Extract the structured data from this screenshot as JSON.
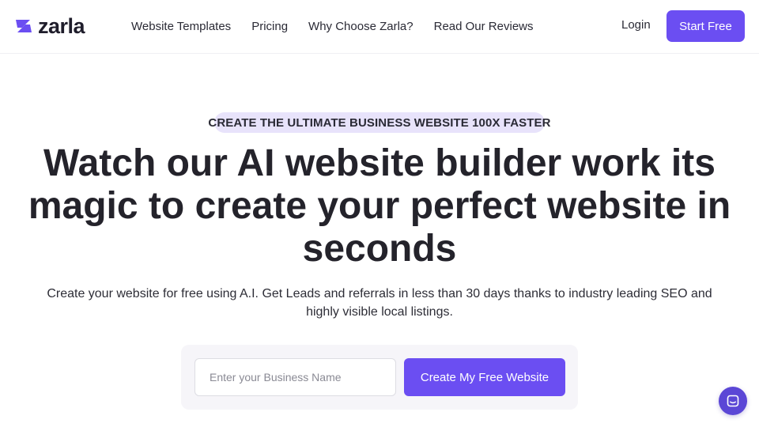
{
  "brand": {
    "name": "zarla",
    "accent_color": "#6b4ef2",
    "logo_icon": "zarla-logo-icon"
  },
  "nav": {
    "items": [
      {
        "label": "Website Templates"
      },
      {
        "label": "Pricing"
      },
      {
        "label": "Why Choose Zarla?"
      },
      {
        "label": "Read Our Reviews"
      }
    ],
    "login_label": "Login",
    "start_label": "Start Free"
  },
  "hero": {
    "tagline": "CREATE THE ULTIMATE BUSINESS WEBSITE 100X FASTER",
    "headline": "Watch our AI website builder work its magic to create your perfect website in seconds",
    "subtext": "Create your website for free using A.I. Get Leads and referrals in less than 30 days thanks to industry leading SEO and highly visible local listings."
  },
  "form": {
    "business_name_placeholder": "Enter your Business Name",
    "business_name_value": "",
    "submit_label": "Create My Free Website"
  },
  "chat": {
    "icon": "chat-icon"
  }
}
